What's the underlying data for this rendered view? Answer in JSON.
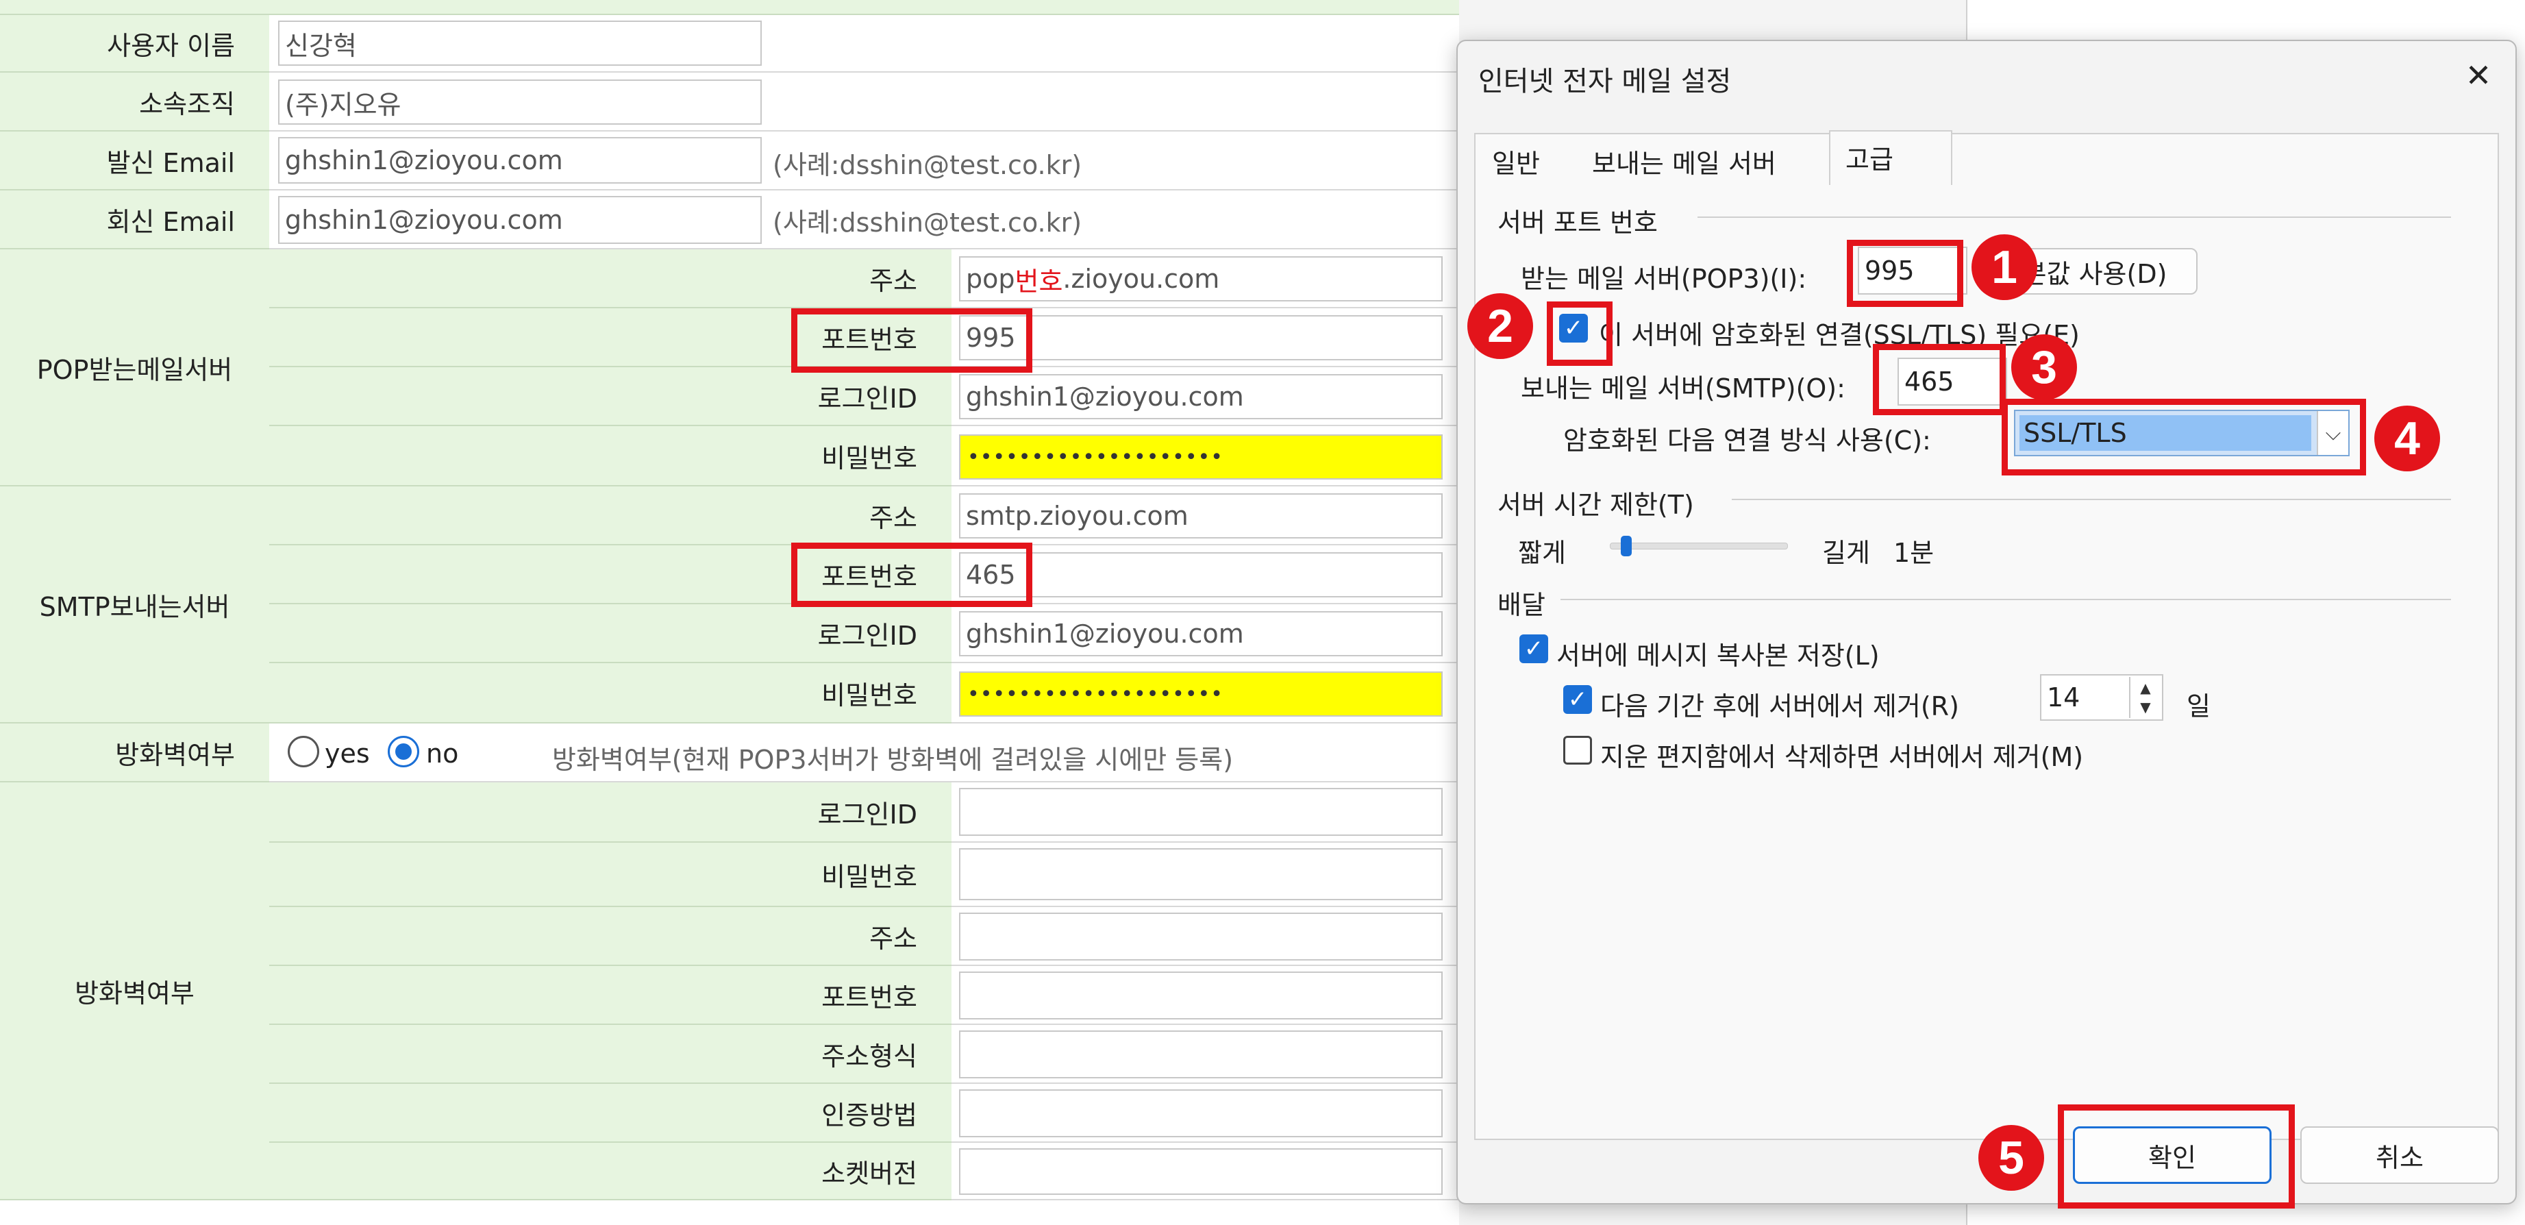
{
  "form": {
    "user_name_label": "사용자 이름",
    "user_name_value": "신강혁",
    "org_label": "소속조직",
    "org_value": "(주)지오유",
    "send_email_label": "발신 Email",
    "send_email_value": "ghshin1@zioyou.com",
    "send_email_hint": "(사례:dsshin@test.co.kr)",
    "reply_email_label": "회신 Email",
    "reply_email_value": "ghshin1@zioyou.com",
    "reply_email_hint": "(사례:dsshin@test.co.kr)",
    "pop_group_label": "POP받는메일서버",
    "pop_address_label": "주소",
    "pop_address_prefix": "pop",
    "pop_address_highlight": "번호",
    "pop_address_suffix": ".zioyou.com",
    "pop_port_label": "포트번호",
    "pop_port_value": "995",
    "pop_login_label": "로그인ID",
    "pop_login_value": "ghshin1@zioyou.com",
    "pop_password_label": "비밀번호",
    "pop_password_value": "••••••••••••••••••••",
    "smtp_group_label": "SMTP보내는서버",
    "smtp_address_label": "주소",
    "smtp_address_value": "smtp.zioyou.com",
    "smtp_port_label": "포트번호",
    "smtp_port_value": "465",
    "smtp_login_label": "로그인ID",
    "smtp_login_value": "ghshin1@zioyou.com",
    "smtp_password_label": "비밀번호",
    "smtp_password_value": "••••••••••••••••••••",
    "firewall_label": "방화벽여부",
    "firewall_yes": "yes",
    "firewall_no": "no",
    "firewall_hint": "방화벽여부(현재 POP3서버가 방화벽에 걸려있을 시에만 등록)",
    "fw_group_label": "방화벽여부",
    "fw_login_label": "로그인ID",
    "fw_password_label": "비밀번호",
    "fw_address_label": "주소",
    "fw_port_label": "포트번호",
    "fw_address_format_label": "주소형식",
    "fw_auth_label": "인증방법",
    "fw_socket_label": "소켓버전"
  },
  "dialog": {
    "title": "인터넷 전자 메일 설정",
    "close_icon": "close-icon",
    "tabs": [
      "일반",
      "보내는 메일 서버",
      "고급"
    ],
    "server_port_section": "서버 포트 번호",
    "pop3_label": "받는 메일 서버(POP3)(I):",
    "pop3_value": "995",
    "default_button": "본값 사용(D)",
    "ssl_required_label": "이 서버에 암호화된 연결(SSL/TLS) 필요(E)",
    "smtp_label": "보내는 메일 서버(SMTP)(O):",
    "smtp_value": "465",
    "encryption_label": "암호화된 다음 연결 방식 사용(C):",
    "encryption_value": "SSL/TLS",
    "timeout_section": "서버 시간 제한(T)",
    "timeout_short": "짧게",
    "timeout_long": "길게",
    "timeout_value": "1분",
    "delivery_section": "배달",
    "leave_copy_label": "서버에 메시지 복사본 저장(L)",
    "remove_after_label": "다음 기간 후에 서버에서 제거(R)",
    "remove_after_days": "14",
    "days_unit": "일",
    "remove_deleted_label": "지운 편지함에서 삭제하면 서버에서 제거(M)",
    "ok_button": "확인",
    "cancel_button": "취소"
  },
  "annotations": [
    "1",
    "2",
    "3",
    "4",
    "5"
  ],
  "colors": {
    "label_bg": "#e7f5e0",
    "highlight_red": "#e3141b",
    "password_yellow": "#ffff00",
    "accent_blue": "#1a6fd6"
  }
}
